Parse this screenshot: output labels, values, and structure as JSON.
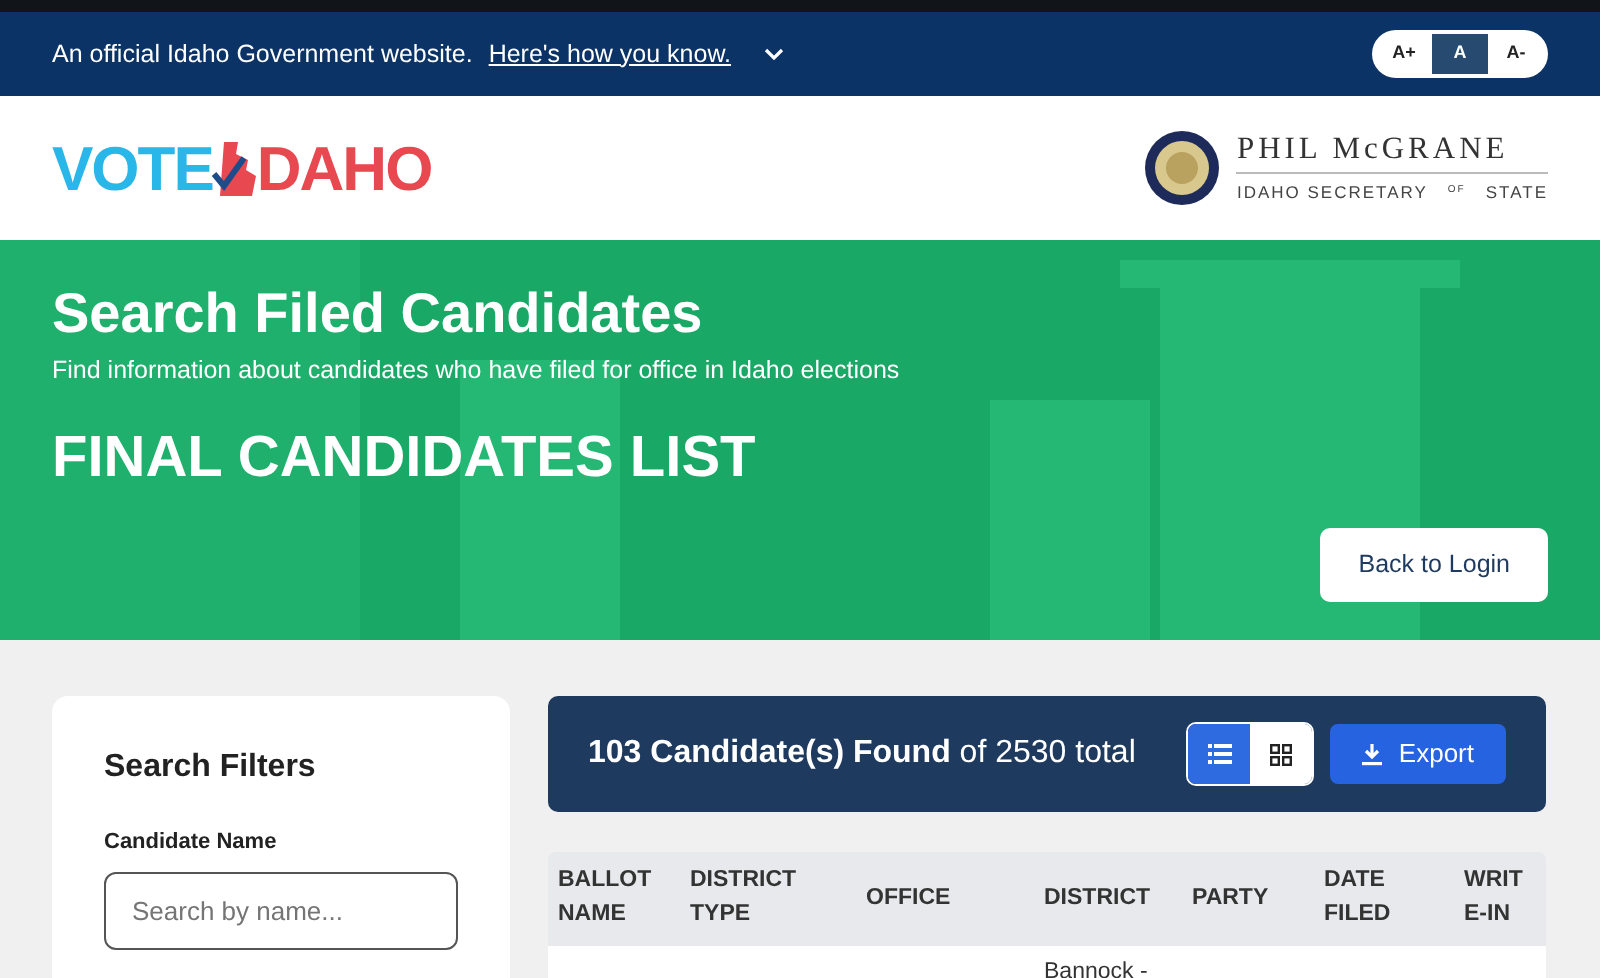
{
  "banner": {
    "text": "An official Idaho Government website.",
    "link": "Here's how you know.",
    "expanded": false
  },
  "font_size_buttons": [
    {
      "label": "A+",
      "selected": false
    },
    {
      "label": "A",
      "selected": true
    },
    {
      "label": "A-",
      "selected": false
    }
  ],
  "logo": {
    "left": "VOTE",
    "right": "DAHO"
  },
  "secretary": {
    "name": "PHIL McGRANE",
    "title_left": "IDAHO SECRETARY",
    "of": "OF",
    "title_right": "STATE"
  },
  "hero": {
    "title": "Search Filed Candidates",
    "subtitle": "Find information about candidates who have filed for office in Idaho elections",
    "list_title": "FINAL CANDIDATES LIST",
    "back_button": "Back to Login"
  },
  "filters": {
    "title": "Search Filters",
    "fields": [
      {
        "label": "Candidate Name",
        "placeholder": "Search by name..."
      }
    ]
  },
  "results": {
    "summary": "**103 Candidate(s) Found** of 2530 total",
    "view_toggle": [
      {
        "kind": "list",
        "selected": true
      },
      {
        "kind": "grid",
        "selected": false
      }
    ],
    "export_button": "Export"
  },
  "table": {
    "columns": [
      "BALLOT NAME",
      "DISTRICT TYPE",
      "OFFICE",
      "DISTRICT",
      "PARTY",
      "DATE FILED",
      "WRITE-IN"
    ],
    "rows": [
      {
        "district": "Bannock -"
      }
    ]
  }
}
